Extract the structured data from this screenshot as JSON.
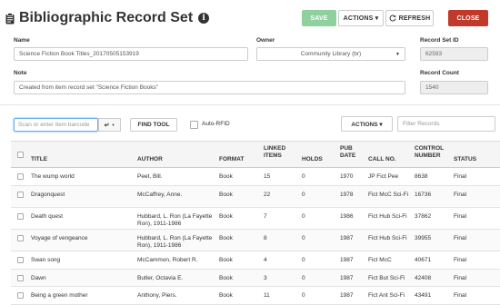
{
  "header": {
    "title": "Bibliographic Record Set",
    "info_icon": "i",
    "save_label": "SAVE",
    "actions_label": "ACTIONS ▾",
    "refresh_label": "REFRESH",
    "close_label": "CLOSE"
  },
  "form": {
    "name_label": "Name",
    "name_value": "Science Fiction Book Titles_20170505153919",
    "owner_label": "Owner",
    "owner_value": "Community Library (br)",
    "record_set_id_label": "Record Set ID",
    "record_set_id_value": "62593",
    "note_label": "Note",
    "note_value": "Created from item record set \"Science Fiction Books\"",
    "record_count_label": "Record Count",
    "record_count_value": "1540"
  },
  "toolbar": {
    "scan_placeholder": "Scan or enter item barcode",
    "enter_glyph": "↵",
    "find_tool_label": "FIND TOOL",
    "auto_rfid_label": "Auto-RFID",
    "actions_label": "ACTIONS ▾",
    "filter_placeholder": "Filter Records"
  },
  "table": {
    "columns": {
      "title": "TITLE",
      "author": "AUTHOR",
      "format": "FORMAT",
      "linked": "LINKED ITEMS",
      "holds": "HOLDS",
      "pubdate": "PUB DATE",
      "callno": "CALL NO.",
      "control": "CONTROL NUMBER",
      "status": "STATUS"
    },
    "rows": [
      {
        "title": "The wump world",
        "author": "Peet, Bill.",
        "format": "Book",
        "linked": "15",
        "holds": "0",
        "pubdate": "1970",
        "callno": "JP Fict Pee",
        "control": "8638",
        "status": "Final"
      },
      {
        "title": "Dragonquest",
        "author": "McCaffrey, Anne.",
        "format": "Book",
        "linked": "22",
        "holds": "0",
        "pubdate": "1978",
        "callno": "Fict McC Sci-Fi",
        "control": "16736",
        "status": "Final"
      },
      {
        "title": "Death quest",
        "author": "Hubbard, L. Ron (La Fayette Ron), 1911-1986",
        "format": "Book",
        "linked": "7",
        "holds": "0",
        "pubdate": "1986",
        "callno": "Fict Hub Sci-Fi",
        "control": "37862",
        "status": "Final"
      },
      {
        "title": "Voyage of vengeance",
        "author": "Hubbard, L. Ron (La Fayette Ron), 1911-1986",
        "format": "Book",
        "linked": "8",
        "holds": "0",
        "pubdate": "1987",
        "callno": "Fict Hub Sci-Fi",
        "control": "39955",
        "status": "Final"
      },
      {
        "title": "Swan song",
        "author": "McCammon, Robert R.",
        "format": "Book",
        "linked": "4",
        "holds": "0",
        "pubdate": "1987",
        "callno": "Fict McC",
        "control": "40671",
        "status": "Final"
      },
      {
        "title": "Dawn",
        "author": "Butler, Octavia E.",
        "format": "Book",
        "linked": "3",
        "holds": "0",
        "pubdate": "1987",
        "callno": "Fict But Sci-Fi",
        "control": "42408",
        "status": "Final"
      },
      {
        "title": "Being a green mother",
        "author": "Anthony, Piers.",
        "format": "Book",
        "linked": "11",
        "holds": "0",
        "pubdate": "1987",
        "callno": "Fict Ant Sci-Fi",
        "control": "43491",
        "status": "Final"
      }
    ]
  },
  "colors": {
    "save": "#8fd19e",
    "close": "#c0392b",
    "focus": "#66afe9"
  },
  "icons": {
    "title": "clipboard-icon",
    "refresh": "refresh-icon",
    "enter": "enter-key-icon",
    "dropdown": "chevron-down-icon"
  }
}
